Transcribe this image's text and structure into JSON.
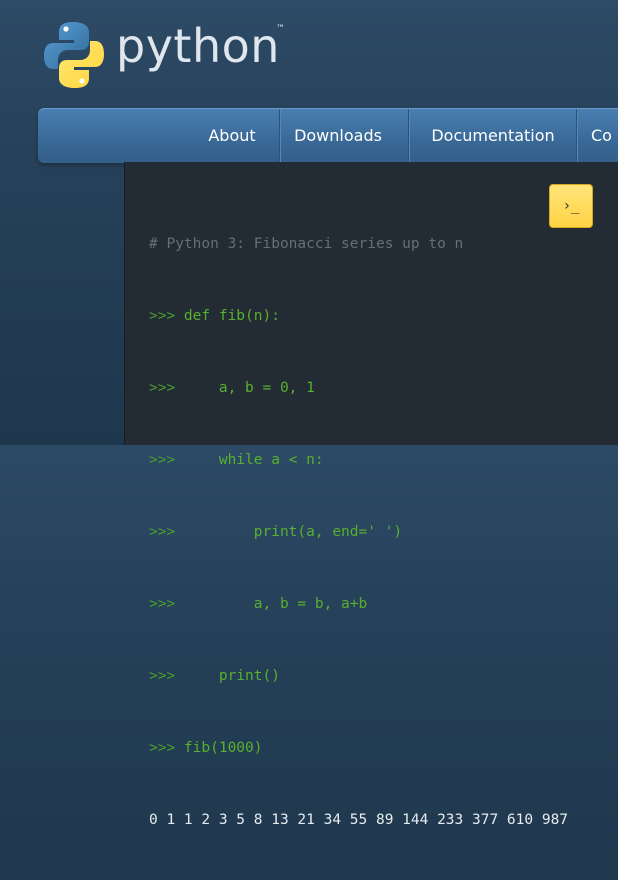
{
  "logo": {
    "text": "python",
    "trademark": "™"
  },
  "nav": {
    "items": [
      {
        "label": "About"
      },
      {
        "label": "Downloads"
      },
      {
        "label": "Documentation"
      },
      {
        "label": "Co"
      }
    ]
  },
  "code": {
    "lines": [
      {
        "prompt": "",
        "text": "# Python 3: Fibonacci series up to n",
        "kind": "comment"
      },
      {
        "prompt": ">>> ",
        "text": "def fib(n):",
        "kind": "code"
      },
      {
        "prompt": ">>> ",
        "text": "    a, b = 0, 1",
        "kind": "code"
      },
      {
        "prompt": ">>> ",
        "text": "    while a < n:",
        "kind": "code"
      },
      {
        "prompt": ">>> ",
        "text": "        print(a, end=' ')",
        "kind": "code"
      },
      {
        "prompt": ">>> ",
        "text": "        a, b = b, a+b",
        "kind": "code"
      },
      {
        "prompt": ">>> ",
        "text": "    print()",
        "kind": "code"
      },
      {
        "prompt": ">>> ",
        "text": "fib(1000)",
        "kind": "code"
      },
      {
        "prompt": "",
        "text": "0 1 1 2 3 5 8 13 21 34 55 89 144 233 377 610 987",
        "kind": "output"
      }
    ]
  },
  "shell_button": {
    "label": "›_",
    "icon": "terminal-icon"
  },
  "colors": {
    "background": "#254058",
    "nav": "#3a6a98",
    "code_bg": "#232b34",
    "code_green": "#58b02f",
    "comment": "#666f78",
    "shell_button": "#ffd343"
  }
}
